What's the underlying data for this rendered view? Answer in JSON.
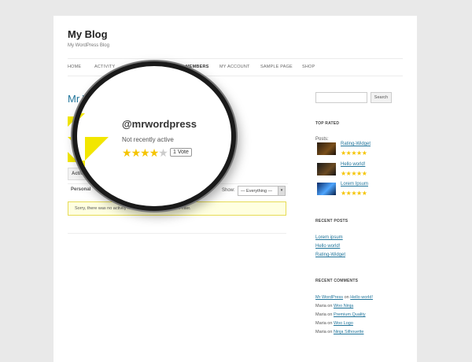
{
  "site": {
    "title": "My Blog",
    "description": "My WordPress Blog"
  },
  "nav": [
    "HOME",
    "ACTIVITY",
    "MEMBERS",
    "MY ACCOUNT",
    "SAMPLE PAGE",
    "SHOP"
  ],
  "profile": {
    "partial_title": "Mr W",
    "partial_title_end": "ress",
    "username": "@mrwordpress",
    "status": "Not recently active",
    "rating": 4,
    "rating_max": 5,
    "vote_label": "1 Vote"
  },
  "tabs": {
    "activity": "Activity",
    "personal": "Personal",
    "next": "M"
  },
  "filter": {
    "label": "Show:",
    "value": "— Everything —"
  },
  "notice": "Sorry, there was no activity found. Please try a different filter.",
  "sidebar": {
    "search_button": "Search",
    "top_rated": {
      "title": "TOP RATED",
      "posts_label": "Posts:",
      "items": [
        {
          "label": "Rating-Widget",
          "rating": 5,
          "stars": "★★★★★"
        },
        {
          "label": "Hello world!",
          "rating": 4.5,
          "stars": "★★★★★"
        },
        {
          "label": "Lorem Ipsum",
          "rating": 4.5,
          "stars": "★★★★★"
        }
      ]
    },
    "recent_posts": {
      "title": "RECENT POSTS",
      "items": [
        "Lorem ipsum",
        "Hello world!",
        "Rating-Widget"
      ]
    },
    "recent_comments": {
      "title": "RECENT COMMENTS",
      "items": [
        {
          "author": "Mr WordPress",
          "on": "on",
          "post": "Hello world!"
        },
        {
          "author": "Maria",
          "on": "on",
          "post": "Woo Ninja"
        },
        {
          "author": "Maria",
          "on": "on",
          "post": "Premium Quality"
        },
        {
          "author": "Maria",
          "on": "on",
          "post": "Woo Logo"
        },
        {
          "author": "Maria",
          "on": "on",
          "post": "Ninja Silhouette"
        }
      ]
    }
  },
  "colors": {
    "link": "#21759b",
    "star": "#f5c400",
    "notice_bg": "#ffffe0"
  }
}
